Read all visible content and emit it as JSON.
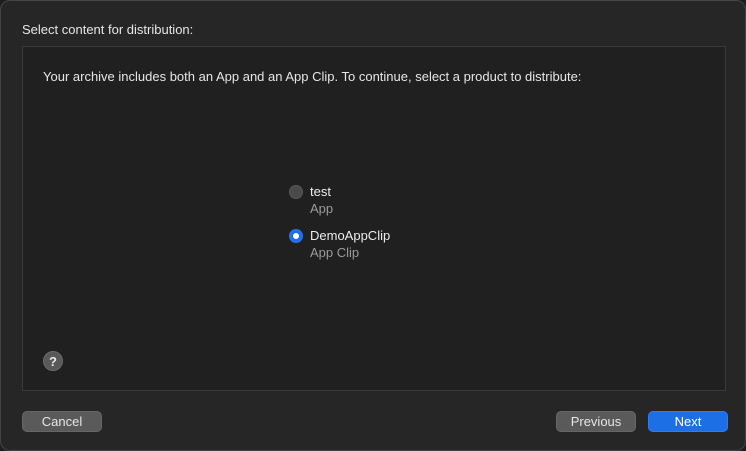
{
  "dialog": {
    "header": "Select content for distribution:",
    "instruction": "Your archive includes both an App and an App Clip. To continue, select a product to distribute:"
  },
  "options": [
    {
      "title": "test",
      "subtitle": "App",
      "selected": false
    },
    {
      "title": "DemoAppClip",
      "subtitle": "App Clip",
      "selected": true
    }
  ],
  "help": {
    "label": "?",
    "icon": "help-icon"
  },
  "buttons": {
    "cancel": "Cancel",
    "previous": "Previous",
    "next": "Next"
  },
  "colors": {
    "accent": "#1d6fe6",
    "window_background": "#262626",
    "panel_background": "#202020"
  }
}
